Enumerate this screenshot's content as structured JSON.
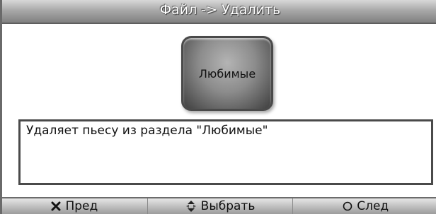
{
  "dialog": {
    "title": "Файл -> Удалить"
  },
  "tile": {
    "label": "Любимые",
    "icon": "folder-tile"
  },
  "description": {
    "text": "Удаляет пьесу из раздела \"Любимые\""
  },
  "footer": {
    "prev": {
      "label": "Пред",
      "icon": "cross-icon"
    },
    "select": {
      "label": "Выбрать",
      "icon": "up-down-arrows-icon"
    },
    "next": {
      "label": "След",
      "icon": "circle-icon"
    }
  }
}
